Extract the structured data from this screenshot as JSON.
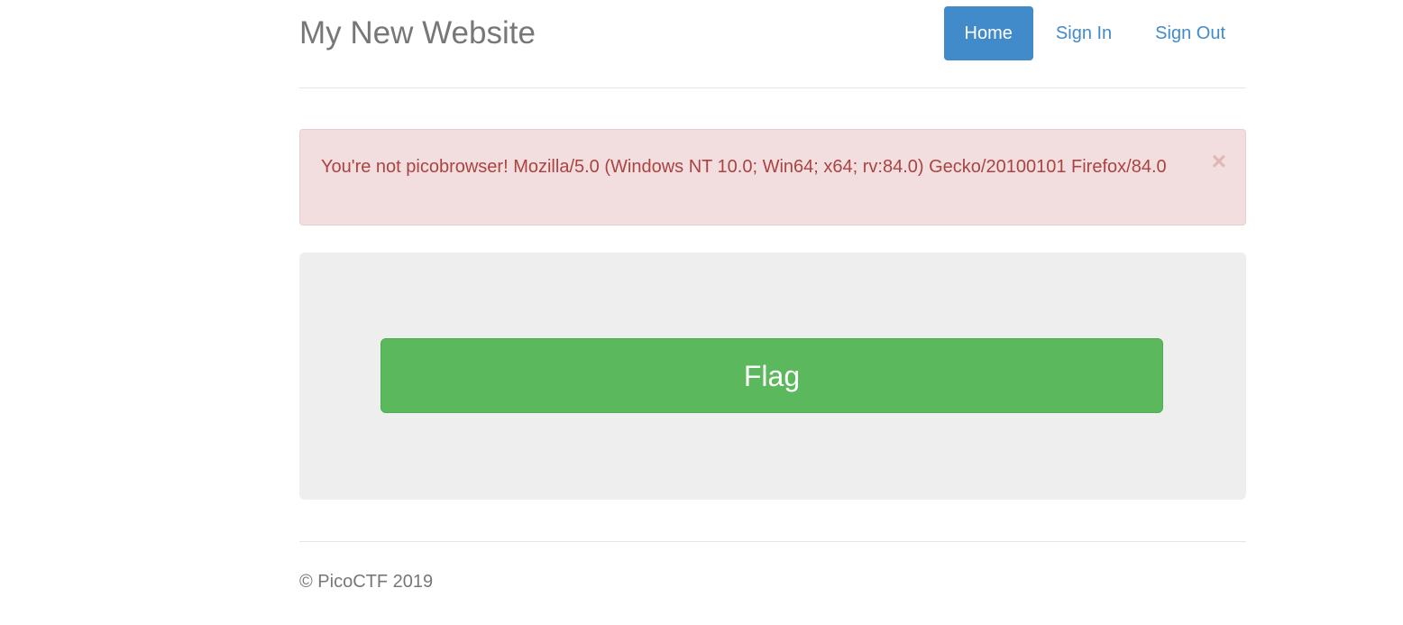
{
  "header": {
    "title": "My New Website",
    "nav": [
      {
        "label": "Home",
        "active": true
      },
      {
        "label": "Sign In",
        "active": false
      },
      {
        "label": "Sign Out",
        "active": false
      }
    ]
  },
  "alert": {
    "message": "You're not picobrowser! Mozilla/5.0 (Windows NT 10.0; Win64; x64; rv:84.0) Gecko/20100101 Firefox/84.0",
    "close_symbol": "×",
    "type": "danger"
  },
  "main": {
    "flag_button_label": "Flag"
  },
  "footer": {
    "text": "© PicoCTF 2019"
  },
  "colors": {
    "primary": "#428bca",
    "success": "#5cb85c",
    "danger_text": "#a94442",
    "danger_bg": "#f2dede",
    "muted": "#777777"
  }
}
